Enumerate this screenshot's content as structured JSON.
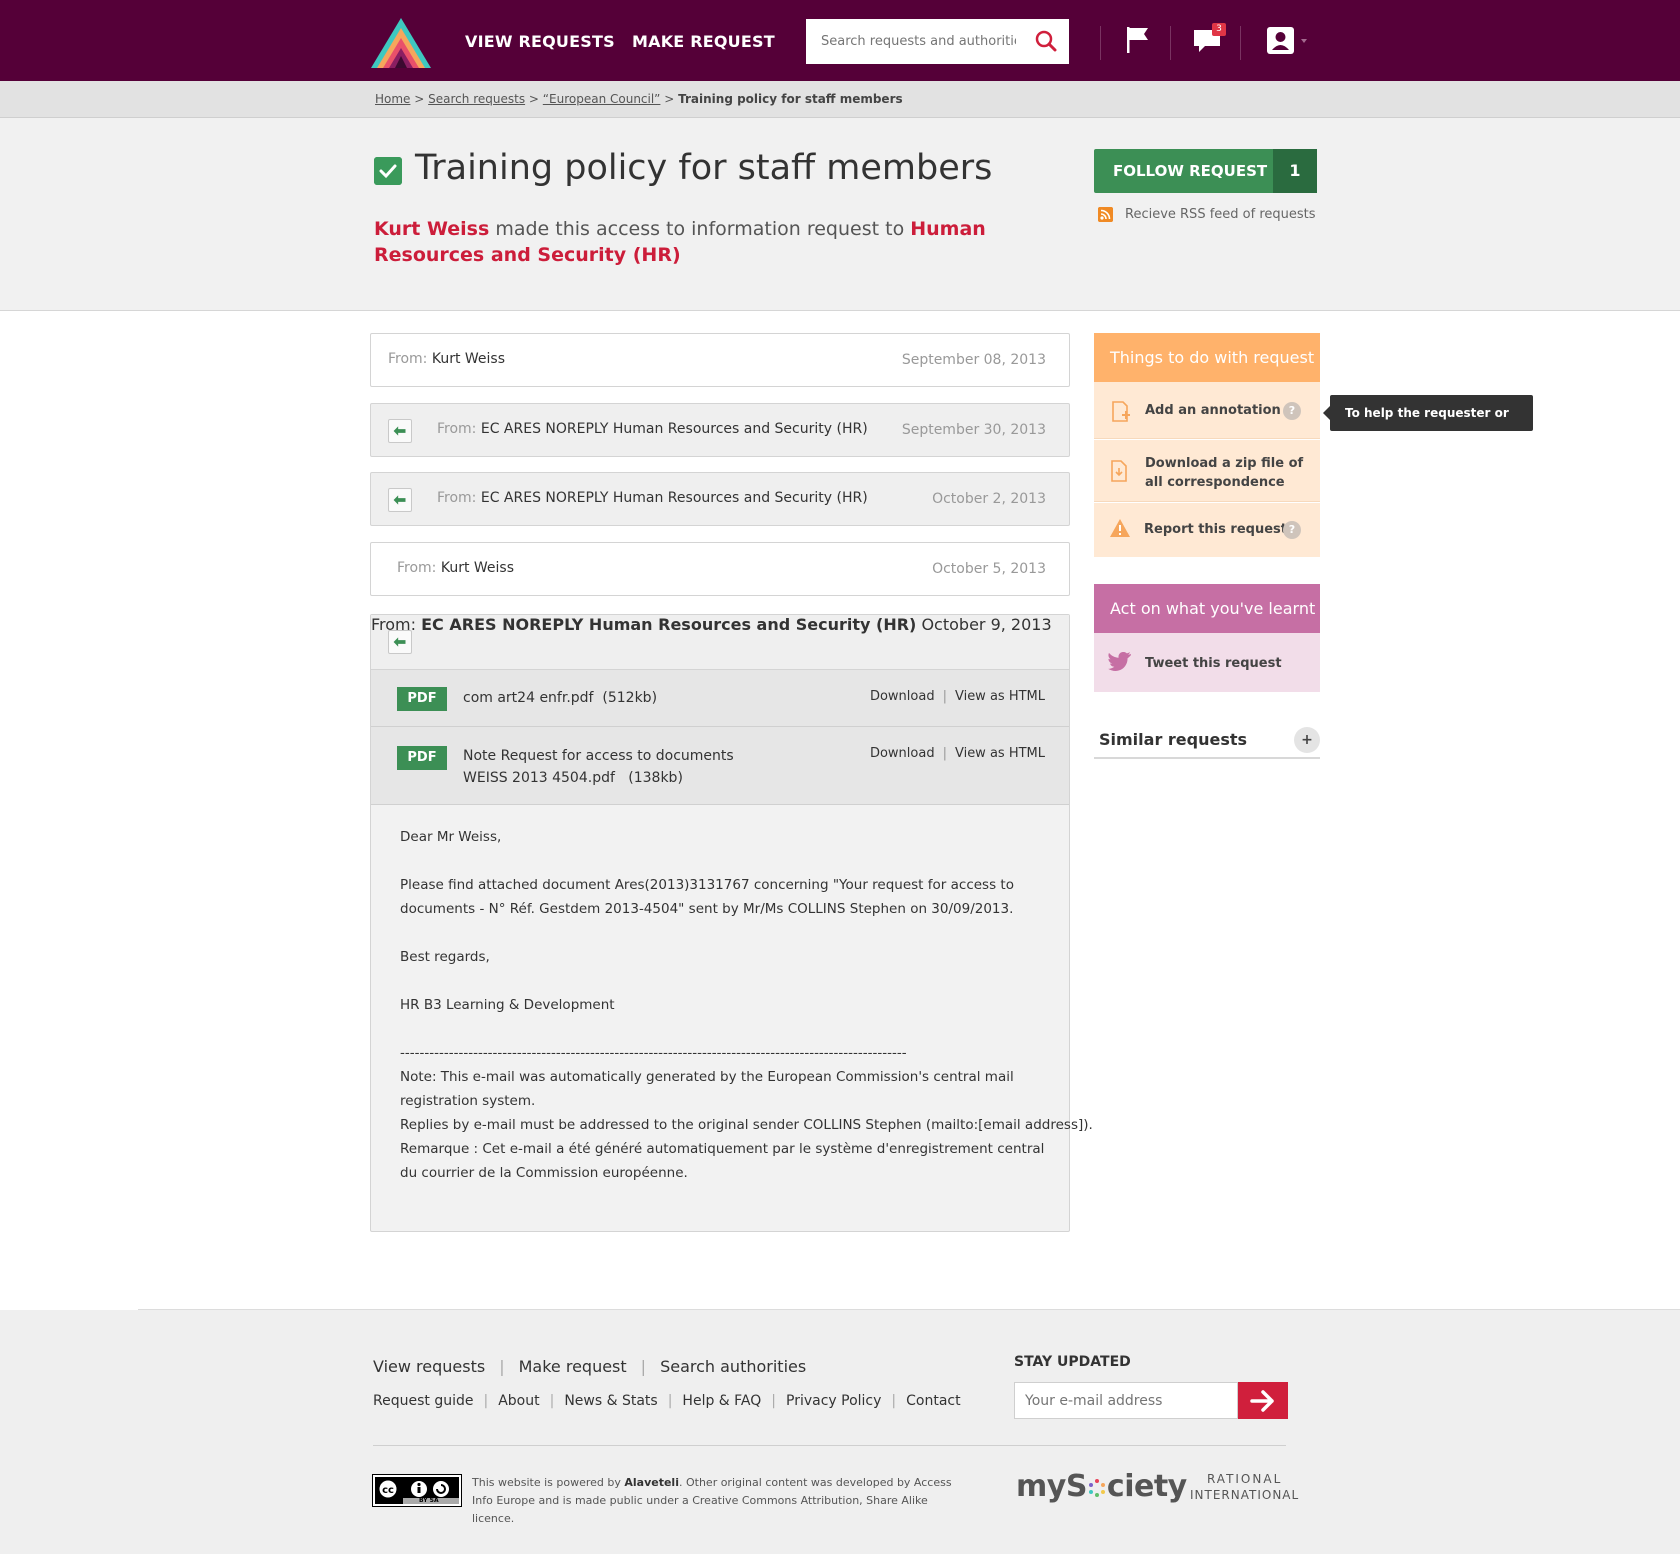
{
  "header": {
    "nav": [
      "VIEW REQUESTS",
      "MAKE REQUEST"
    ],
    "search_placeholder": "Search requests and authorities",
    "notification_count": "3"
  },
  "breadcrumb": {
    "items": [
      "Home",
      "Search requests",
      "“European Council”"
    ],
    "separator": ">",
    "current": "Training policy for staff members"
  },
  "request": {
    "title": "Training policy for staff members",
    "requester": "Kurt Weiss",
    "middle_text": "made this access to information request to",
    "authority": "Human Resources and Security (HR)",
    "follow_label": "FOLLOW REQUEST",
    "follow_count": "1",
    "rss_label": "Recieve RSS feed of requests"
  },
  "correspondence": [
    {
      "from_label": "From:",
      "sender": "Kurt Weiss",
      "date": "September 08, 2013"
    },
    {
      "from_label": "From:",
      "sender": "EC ARES NOREPLY Human Resources and Security (HR)",
      "date": "September 30, 2013"
    },
    {
      "from_label": "From:",
      "sender": "EC ARES NOREPLY Human Resources and Security (HR)",
      "date": "October 2, 2013"
    },
    {
      "from_label": "From:",
      "sender": "Kurt Weiss",
      "date": "October 5, 2013"
    },
    {
      "from_label": "From:",
      "sender": "EC ARES NOREPLY Human Resources and Security (HR)",
      "date": "October 9, 2013"
    }
  ],
  "attachments": [
    {
      "type": "PDF",
      "name_line1": "com art24 enfr.pdf",
      "size": "(512kb)",
      "download": "Download",
      "view": "View as HTML"
    },
    {
      "type": "PDF",
      "name_line1": "Note Request for access to documents",
      "name_line2": "WEISS 2013 4504.pdf",
      "size": "(138kb)",
      "download": "Download",
      "view": "View as HTML"
    }
  ],
  "message": {
    "greeting": "Dear Mr Weiss,",
    "para1": "Please find attached document Ares(2013)3131767 concerning \"Your request for access to documents - N° Réf. Gestdem 2013-4504\" sent by Mr/Ms COLLINS Stephen on 30/09/2013.",
    "regards": "Best regards,",
    "signature": "HR B3 Learning & Development",
    "divider": "--------------------------------------------------------------------------------------------------------",
    "note1": "Note: This e-mail was automatically generated by the European Commission's central mail registration system.",
    "note2": "Replies by e-mail must be addressed to the original sender COLLINS Stephen (mailto:[email address]).",
    "note3": "Remarque : Cet e-mail a été généré automatiquement par le système d'enregistrement central",
    "note4": "du courrier de la Commission européenne."
  },
  "sidebar": {
    "things_title": "Things to do with request",
    "add_annotation": "Add an annotation",
    "annotation_tooltip": "To help the requester or others",
    "download_zip_line1": "Download a zip file of",
    "download_zip_line2": "all correspondence",
    "report": "Report this request",
    "help_glyph": "?",
    "act_title": "Act on what you've learnt",
    "tweet": "Tweet this request",
    "similar_title": "Similar requests",
    "similar_toggle": "+",
    "colors": {
      "things_head": "#ffb26b",
      "things_body": "#ffe9d4",
      "act_head": "#c66fa4",
      "act_body": "#f2dde9"
    }
  },
  "footer": {
    "nav1": [
      "View requests",
      "Make request",
      "Search authorities"
    ],
    "nav2": [
      "Request guide",
      "About",
      "News & Stats",
      "Help &  FAQ",
      "Privacy Policy",
      "Contact"
    ],
    "stay_updated": "STAY UPDATED",
    "email_placeholder": "Your e-mail address",
    "legal_prefix": "This website is powered by",
    "legal_brand": "Alaveteli",
    "legal_rest": ". Other original content was developed by Access Info Europe and is made public under a Creative Commons Attribution, Share Alike licence.",
    "cc_text": "BY  SA",
    "mysociety_a": "myS",
    "mysociety_b": "ciety",
    "rational_line1": "RATIONAL",
    "rational_line2": "INTERNATIONAL"
  },
  "theme": {
    "primary": "#550038",
    "accent_red": "#cc1d3a",
    "green": "#3c8f55"
  }
}
